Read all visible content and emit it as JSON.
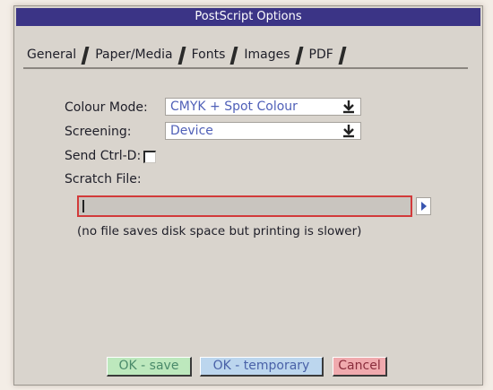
{
  "window": {
    "title": "PostScript Options"
  },
  "tabs": [
    {
      "label": "General",
      "active": true
    },
    {
      "label": "Paper/Media",
      "active": false
    },
    {
      "label": "Fonts",
      "active": false
    },
    {
      "label": "Images",
      "active": false
    },
    {
      "label": "PDF",
      "active": false
    }
  ],
  "general": {
    "colour_mode": {
      "label": "Colour Mode:",
      "value": "CMYK + Spot Colour"
    },
    "screening": {
      "label": "Screening:",
      "value": "Device"
    },
    "send_ctrl_d": {
      "label": "Send Ctrl-D:",
      "checked": false
    },
    "scratch_file": {
      "label": "Scratch File:",
      "value": "",
      "hint": "(no file saves disk space but printing is slower)"
    }
  },
  "buttons": {
    "ok_save": "OK - save",
    "ok_temporary": "OK - temporary",
    "cancel": "Cancel"
  },
  "colors": {
    "title_bar": "#3b3486",
    "dialog_bg": "#d9d4cd",
    "input_border_error": "#d23a3a",
    "save_bg": "#bde8bd",
    "temporary_bg": "#bcd6ee",
    "cancel_bg": "#f0aaae"
  }
}
